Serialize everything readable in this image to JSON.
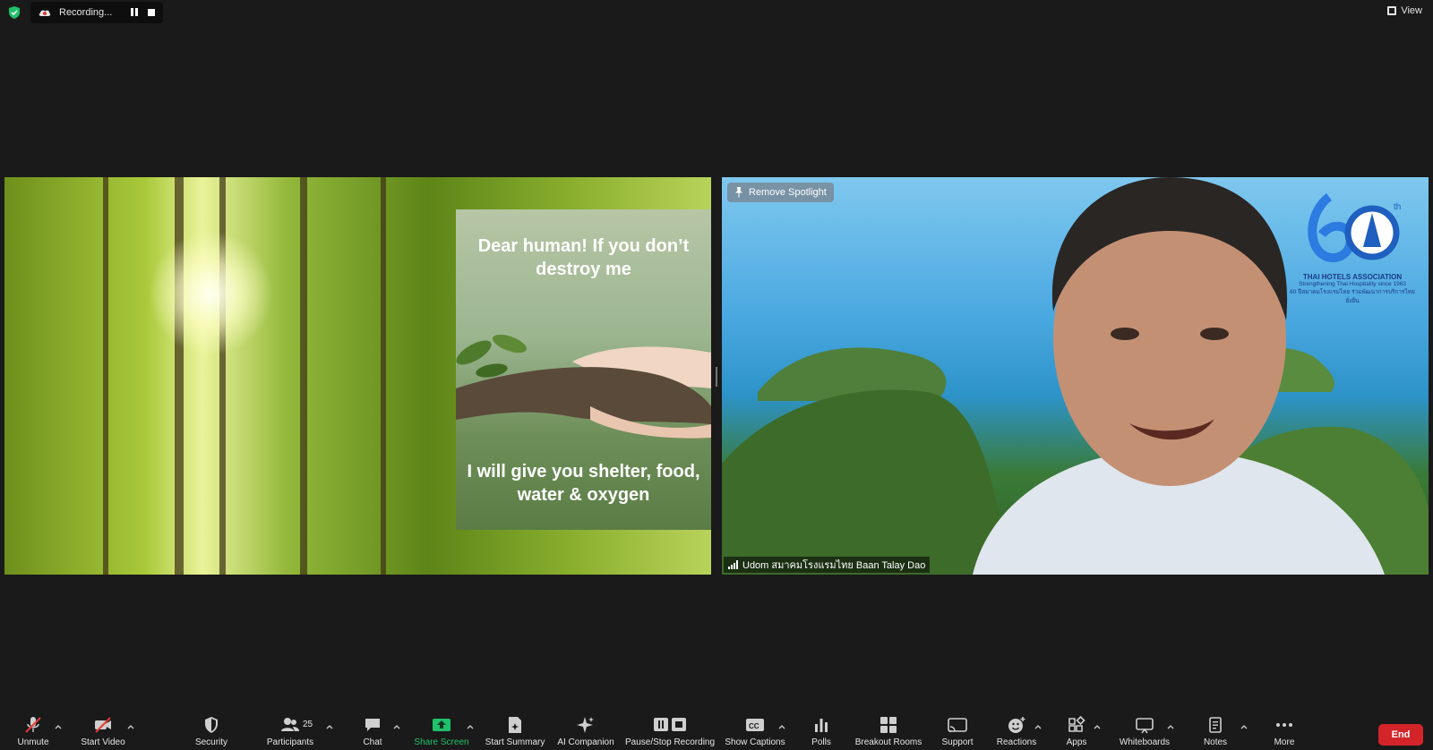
{
  "topbar": {
    "recording_label": "Recording...",
    "view_label": "View"
  },
  "left_tile": {
    "poster_text_top": "Dear human! If you don’t destroy me",
    "poster_text_bottom": "I will give you shelter, food, water & oxygen"
  },
  "right_tile": {
    "spotlight_label": "Remove Spotlight",
    "logo_name": "THAI HOTELS ASSOCIATION",
    "logo_tagline": "Strengthening Thai Hospitality since 1963",
    "logo_tagline_thai": "60 ปีสมาคมโรงแรมไทย ร่วมพัฒนาการบริการไทยยั่งยืน",
    "participant_name": "Udom สมาคมโรงแรมไทย Baan Talay Dao"
  },
  "toolbar": {
    "items": [
      {
        "label": "Unmute",
        "icon": "microphone-muted-icon"
      },
      {
        "label": "Start Video",
        "icon": "video-off-icon"
      },
      {
        "label": "Security",
        "icon": "shield-icon"
      },
      {
        "label": "Participants",
        "icon": "participants-icon"
      },
      {
        "label": "Chat",
        "icon": "chat-icon"
      },
      {
        "label": "Share Screen",
        "icon": "share-screen-icon"
      },
      {
        "label": "Start Summary",
        "icon": "summary-icon"
      },
      {
        "label": "AI Companion",
        "icon": "sparkle-icon"
      },
      {
        "label": "Pause/Stop Recording",
        "icon": "pause-stop-icon"
      },
      {
        "label": "Show Captions",
        "icon": "captions-icon"
      },
      {
        "label": "Polls",
        "icon": "polls-icon"
      },
      {
        "label": "Breakout Rooms",
        "icon": "breakout-rooms-icon"
      },
      {
        "label": "Support",
        "icon": "support-icon"
      },
      {
        "label": "Reactions",
        "icon": "reactions-icon"
      },
      {
        "label": "Apps",
        "icon": "apps-icon"
      },
      {
        "label": "Whiteboards",
        "icon": "whiteboard-icon"
      },
      {
        "label": "Notes",
        "icon": "notes-icon"
      },
      {
        "label": "More",
        "icon": "more-icon"
      }
    ],
    "participants_count": "25",
    "end_label": "End"
  },
  "colors": {
    "background": "#1a1a1a",
    "share_green": "#1fc16b",
    "end_red": "#d3242a",
    "shield_green": "#1fc16b"
  }
}
